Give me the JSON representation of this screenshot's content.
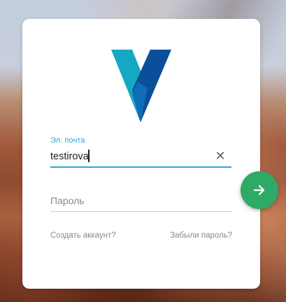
{
  "form": {
    "email_label": "Эл. почта",
    "email_value": "testirova",
    "password_placeholder": "Пароль",
    "create_account_link": "Создать аккаунт?",
    "forgot_password_link": "Забыли пароль?"
  },
  "icons": {
    "logo": "v-logo",
    "clear": "close-icon",
    "submit": "arrow-right-icon"
  },
  "colors": {
    "accent": "#2aa7d6",
    "submit_button": "#2eaa66",
    "logo_light": "#13a7c0",
    "logo_dark": "#0a4d98"
  }
}
